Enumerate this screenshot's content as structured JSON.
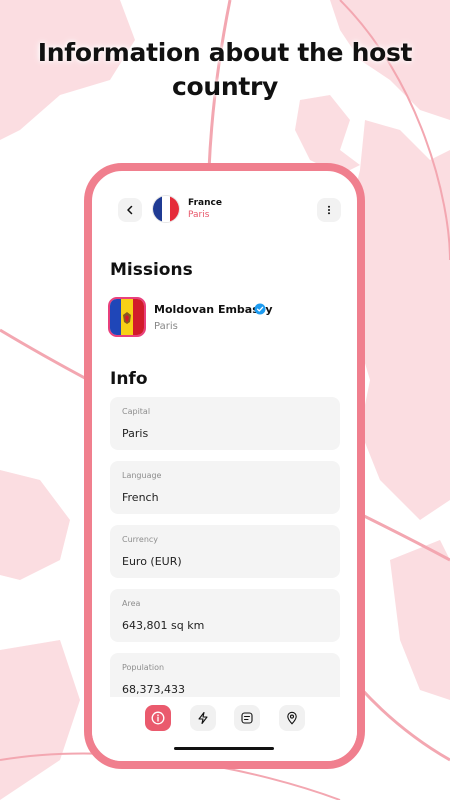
{
  "headline": "Information about the host country",
  "header": {
    "country": "France",
    "city": "Paris",
    "back_icon": "chevron-left-icon",
    "more_icon": "more-vertical-icon",
    "flag_colors": [
      "#1f3a93",
      "#ffffff",
      "#e52b3a"
    ]
  },
  "missions": {
    "title": "Missions",
    "items": [
      {
        "name": "Moldovan Embassy",
        "city": "Paris",
        "verified": true,
        "flag_colors": [
          "#1f46b8",
          "#f7d116",
          "#d21b2a"
        ]
      }
    ]
  },
  "info": {
    "title": "Info",
    "items": [
      {
        "label": "Capital",
        "value": "Paris"
      },
      {
        "label": "Language",
        "value": "French"
      },
      {
        "label": "Currency",
        "value": "Euro (EUR)"
      },
      {
        "label": "Area",
        "value": "643,801 sq km"
      },
      {
        "label": "Population",
        "value": "68,373,433"
      }
    ]
  },
  "nav": {
    "items": [
      {
        "icon": "info-icon",
        "active": true
      },
      {
        "icon": "lightning-icon",
        "active": false
      },
      {
        "icon": "notes-icon",
        "active": false
      },
      {
        "icon": "map-pin-icon",
        "active": false
      }
    ]
  },
  "colors": {
    "accent": "#ea5a6d",
    "frame": "#f07f8e",
    "background_map": "#fbdde1"
  }
}
